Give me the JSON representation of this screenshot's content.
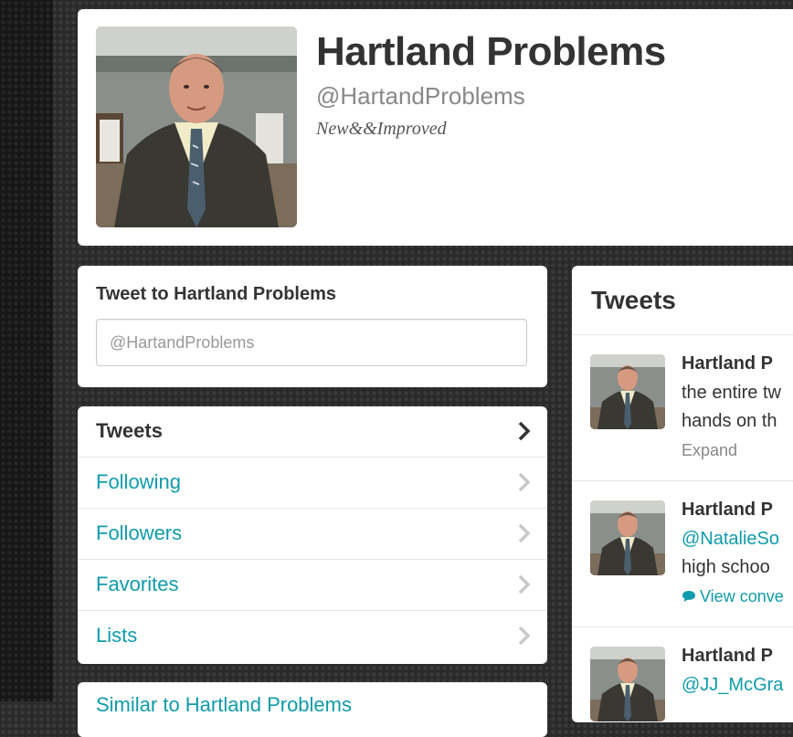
{
  "profile": {
    "name": "Hartland Problems",
    "handle": "@HartandProblems",
    "bio": "New&&Improved"
  },
  "tweet_to": {
    "title": "Tweet to Hartland Problems",
    "placeholder": "@HartandProblems"
  },
  "nav": {
    "items": [
      {
        "label": "Tweets",
        "active": true
      },
      {
        "label": "Following"
      },
      {
        "label": "Followers"
      },
      {
        "label": "Favorites"
      },
      {
        "label": "Lists"
      }
    ],
    "partial_label": "Similar to Hartland Problems"
  },
  "timeline": {
    "title": "Tweets",
    "tweets": [
      {
        "name": "Hartland P",
        "line1": "the entire tw",
        "line2": "hands on th",
        "action": "Expand"
      },
      {
        "name": "Hartland P",
        "line1": "@NatalieSo",
        "line2": "high schoo",
        "action": "View conve"
      },
      {
        "name": "Hartland P",
        "line1": "@JJ_McGra",
        "line2": "",
        "action": ""
      }
    ]
  },
  "icons": {
    "chevron": "chevron-right-icon",
    "speech": "speech-bubble-icon"
  },
  "colors": {
    "accent": "#0f9bab",
    "text": "#333333",
    "muted": "#888888",
    "background": "#2a2a2a"
  }
}
